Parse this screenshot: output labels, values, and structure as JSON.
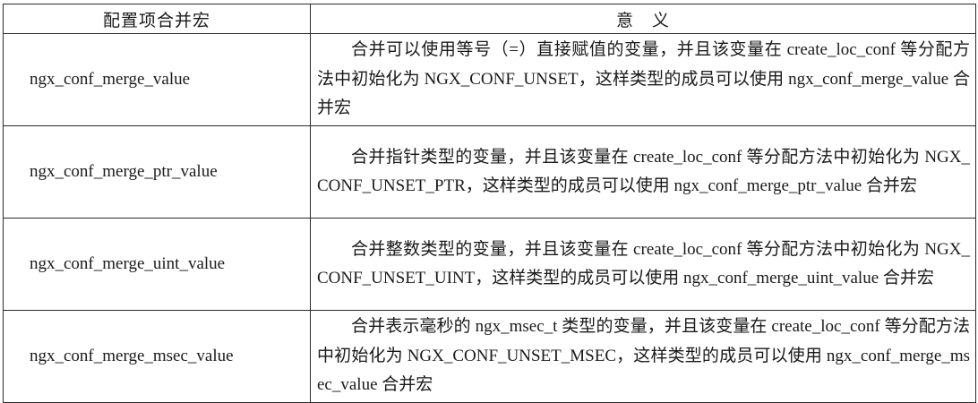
{
  "table": {
    "headers": [
      "配置项合并宏",
      "意　义"
    ],
    "rows": [
      {
        "name": "ngx_conf_merge_value",
        "meaning": "合并可以使用等号（=）直接赋值的变量，并且该变量在 create_loc_conf 等分配方法中初始化为 NGX_CONF_UNSET，这样类型的成员可以使用 ngx_conf_merge_value 合并宏"
      },
      {
        "name": "ngx_conf_merge_ptr_value",
        "meaning": "合并指针类型的变量，并且该变量在 create_loc_conf 等分配方法中初始化为 NGX_CONF_UNSET_PTR，这样类型的成员可以使用 ngx_conf_merge_ptr_value 合并宏"
      },
      {
        "name": "ngx_conf_merge_uint_value",
        "meaning": "合并整数类型的变量，并且该变量在 create_loc_conf 等分配方法中初始化为 NGX_CONF_UNSET_UINT，这样类型的成员可以使用 ngx_conf_merge_uint_value 合并宏"
      },
      {
        "name": "ngx_conf_merge_msec_value",
        "meaning": "合并表示毫秒的 ngx_msec_t 类型的变量，并且该变量在 create_loc_conf 等分配方法中初始化为 NGX_CONF_UNSET_MSEC，这样类型的成员可以使用 ngx_conf_merge_msec_value 合并宏"
      }
    ]
  }
}
